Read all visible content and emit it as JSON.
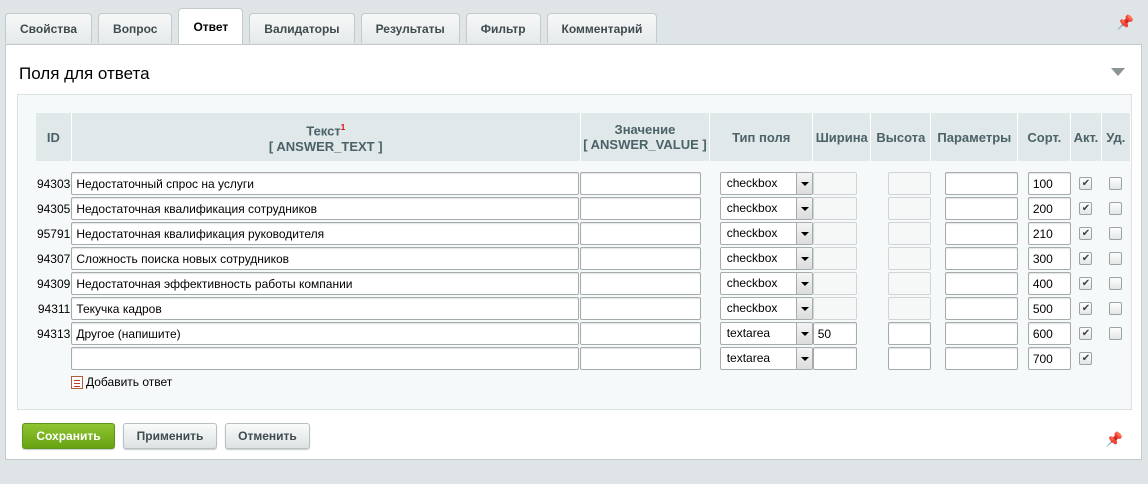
{
  "tabs": [
    {
      "label": "Свойства",
      "active": false
    },
    {
      "label": "Вопрос",
      "active": false
    },
    {
      "label": "Ответ",
      "active": true
    },
    {
      "label": "Валидаторы",
      "active": false
    },
    {
      "label": "Результаты",
      "active": false
    },
    {
      "label": "Фильтр",
      "active": false
    },
    {
      "label": "Комментарий",
      "active": false
    }
  ],
  "section": {
    "title": "Поля для ответа"
  },
  "table": {
    "headers": {
      "id": "ID",
      "text": "Текст",
      "text_footnote": "1",
      "text_sub": "[ ANSWER_TEXT ]",
      "value": "Значение",
      "value_sub": "[ ANSWER_VALUE ]",
      "type": "Тип поля",
      "width": "Ширина",
      "height": "Высота",
      "params": "Параметры",
      "sort": "Сорт.",
      "active": "Акт.",
      "delete": "Уд."
    },
    "rows": [
      {
        "id": "94303",
        "text": "Недостаточный спрос на услуги",
        "value": "",
        "type": "checkbox",
        "width": "",
        "height": "",
        "params": "",
        "sort": "100",
        "active": true,
        "deletable": true
      },
      {
        "id": "94305",
        "text": "Недостаточная квалификация сотрудников",
        "value": "",
        "type": "checkbox",
        "width": "",
        "height": "",
        "params": "",
        "sort": "200",
        "active": true,
        "deletable": true
      },
      {
        "id": "95791",
        "text": "Недостаточная квалификация руководителя",
        "value": "",
        "type": "checkbox",
        "width": "",
        "height": "",
        "params": "",
        "sort": "210",
        "active": true,
        "deletable": true
      },
      {
        "id": "94307",
        "text": "Сложность поиска новых сотрудников",
        "value": "",
        "type": "checkbox",
        "width": "",
        "height": "",
        "params": "",
        "sort": "300",
        "active": true,
        "deletable": true
      },
      {
        "id": "94309",
        "text": "Недостаточная эффективность работы компании",
        "value": "",
        "type": "checkbox",
        "width": "",
        "height": "",
        "params": "",
        "sort": "400",
        "active": true,
        "deletable": true
      },
      {
        "id": "94311",
        "text": "Текучка кадров",
        "value": "",
        "type": "checkbox",
        "width": "",
        "height": "",
        "params": "",
        "sort": "500",
        "active": true,
        "deletable": true
      },
      {
        "id": "94313",
        "text": "Другое (напишите)",
        "value": "",
        "type": "textarea",
        "width": "50",
        "height": "",
        "params": "",
        "sort": "600",
        "active": true,
        "deletable": true
      },
      {
        "id": "",
        "text": "",
        "value": "",
        "type": "textarea",
        "width": "",
        "height": "",
        "params": "",
        "sort": "700",
        "active": true,
        "deletable": false
      }
    ],
    "add_answer": "Добавить ответ"
  },
  "buttons": {
    "save": "Сохранить",
    "apply": "Применить",
    "cancel": "Отменить"
  },
  "colors": {
    "accent": "#7cb523",
    "header_bg": "#e0e8ea"
  }
}
